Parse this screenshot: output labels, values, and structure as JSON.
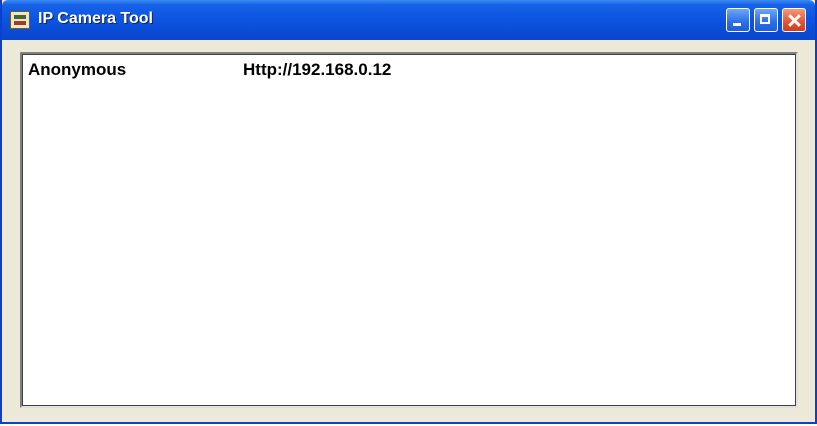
{
  "window": {
    "title": "IP Camera Tool"
  },
  "devices": [
    {
      "user": "Anonymous",
      "url": "Http://192.168.0.12"
    }
  ],
  "icons": {
    "app": "camera-tool-icon",
    "minimize": "minimize-icon",
    "maximize": "maximize-icon",
    "close": "close-icon"
  },
  "colors": {
    "titlebar": "#0c54e0",
    "window_face": "#ece9d8",
    "close_button": "#e2593a"
  }
}
